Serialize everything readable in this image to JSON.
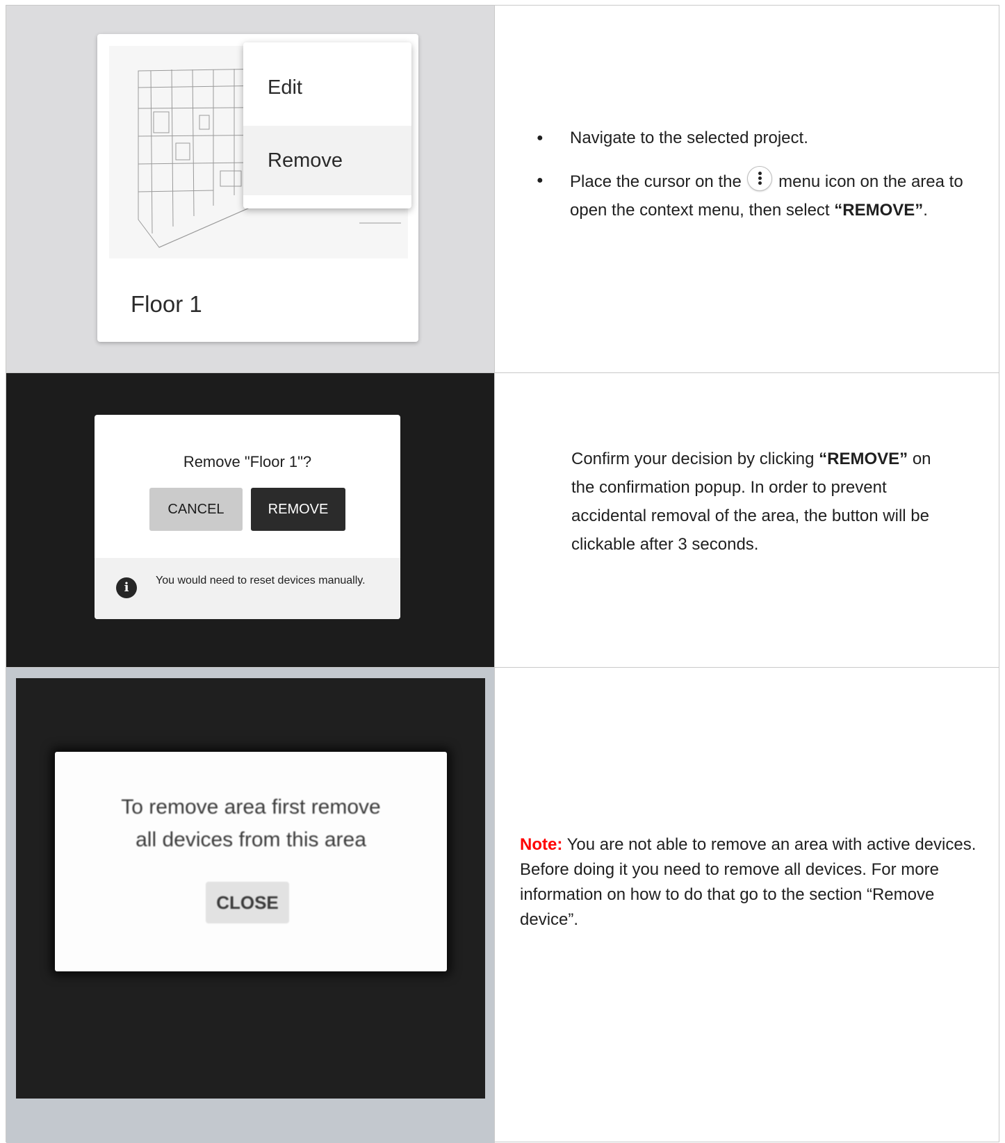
{
  "row1": {
    "card_title": "Floor 1",
    "menu": {
      "edit_label": "Edit",
      "remove_label": "Remove"
    },
    "bullets": [
      {
        "text": "Navigate to the selected project."
      },
      {
        "before_icon": "Place the cursor on the ",
        "icon": "kebab-menu-icon",
        "after_icon": " menu icon on the area to open the context menu, then select ",
        "bold": "“REMOVE”",
        "end": "."
      }
    ]
  },
  "row2": {
    "dialog_title": "Remove \"Floor 1\"?",
    "cancel_label": "CANCEL",
    "remove_label": "REMOVE",
    "footer_text": "You would need to reset devices manually.",
    "description_before": "Confirm your decision by clicking ",
    "description_bold": "“REMOVE”",
    "description_after": " on the confirmation popup. In order to prevent accidental removal of the area, the button will be clickable after 3 seconds."
  },
  "row3": {
    "dialog_line1": "To remove area first remove",
    "dialog_line2": "all devices from this area",
    "close_label": "CLOSE",
    "note_label": "Note:",
    "note_text": " You are not able to remove an area with active devices. Before doing it you need to remove all devices. For more information on how to do that go to the section “Remove device”."
  },
  "colors": {
    "note_red": "#ff0000",
    "remove_button": "#2b2b2b",
    "cancel_button": "#cbcbcb"
  }
}
